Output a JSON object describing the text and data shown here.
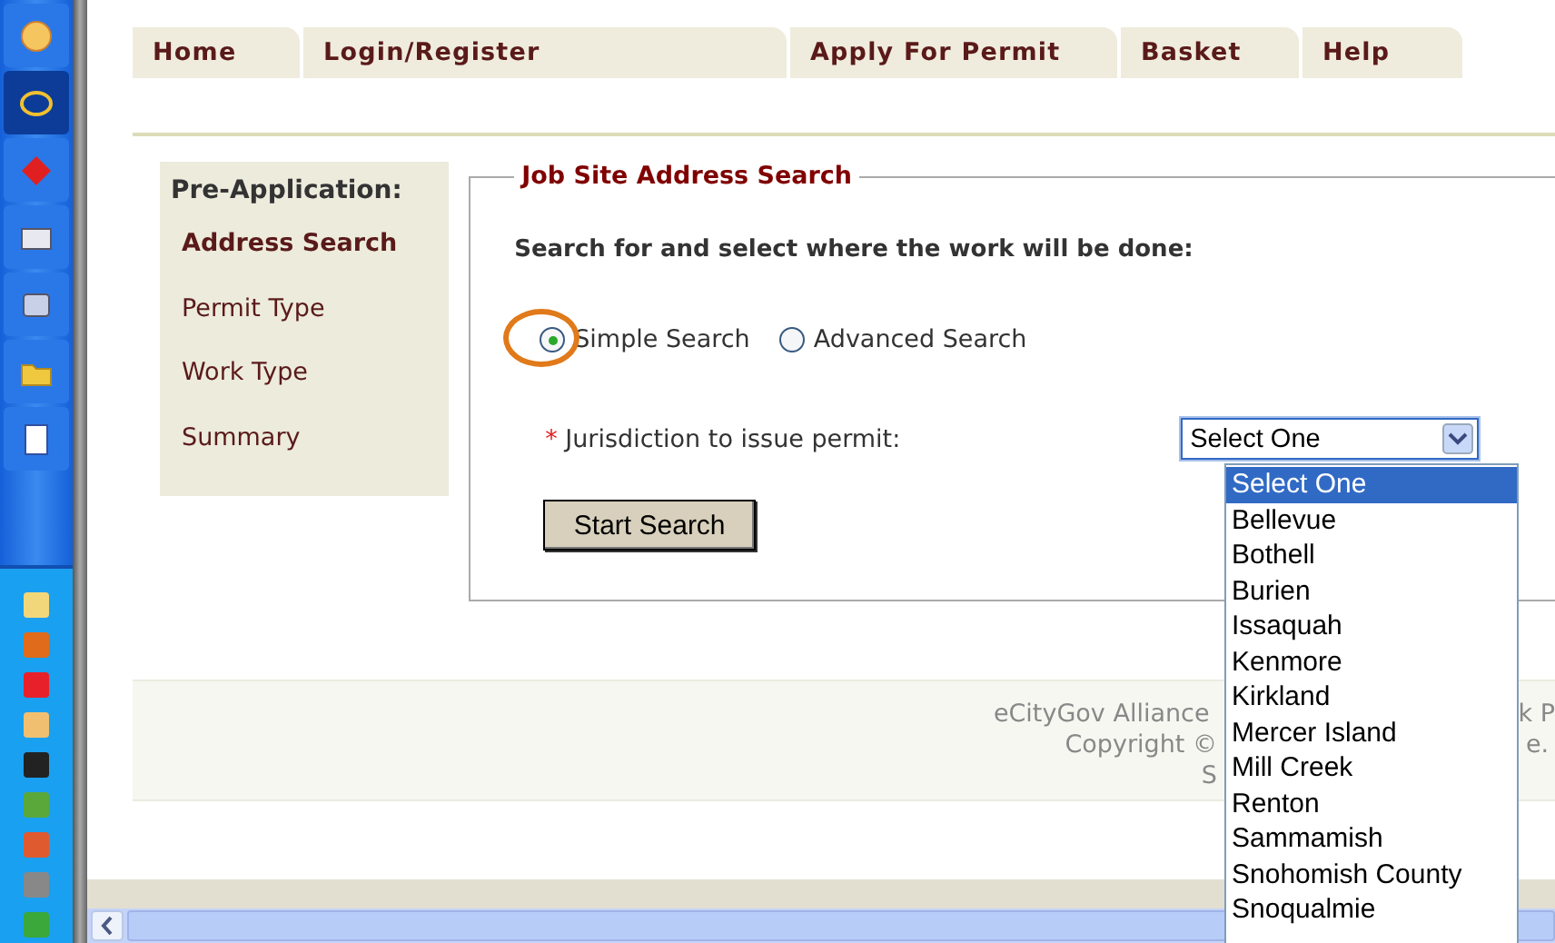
{
  "taskbar": {
    "tiles": [
      {
        "selected": false
      },
      {
        "selected": true
      },
      {
        "selected": false
      },
      {
        "selected": false
      },
      {
        "selected": false
      },
      {
        "selected": false
      },
      {
        "selected": false
      }
    ]
  },
  "nav_tabs": [
    {
      "label": "Home"
    },
    {
      "label": "Login/Register"
    },
    {
      "label": "Apply For Permit"
    },
    {
      "label": "Basket"
    },
    {
      "label": "Help"
    }
  ],
  "sidebar": {
    "heading": "Pre-Application:",
    "steps": [
      {
        "label": "Address Search",
        "selected": true
      },
      {
        "label": "Permit Type",
        "selected": false
      },
      {
        "label": "Work Type",
        "selected": false
      },
      {
        "label": "Summary",
        "selected": false
      }
    ]
  },
  "address_search": {
    "title": "Job Site Address Search",
    "instruction": "Search for and select where the work will be done:",
    "search_modes": [
      {
        "label": "Simple Search",
        "selected": true,
        "highlighted": true
      },
      {
        "label": "Advanced Search",
        "selected": false,
        "highlighted": false
      }
    ],
    "jurisdiction": {
      "required_mark": "*",
      "label": "Jurisdiction to issue permit:",
      "value": "Select One",
      "expanded": true,
      "options": [
        {
          "label": "Select One",
          "selected": true
        },
        {
          "label": "Bellevue",
          "selected": false
        },
        {
          "label": "Bothell",
          "selected": false
        },
        {
          "label": "Burien",
          "selected": false
        },
        {
          "label": "Issaquah",
          "selected": false
        },
        {
          "label": "Kenmore",
          "selected": false
        },
        {
          "label": "Kirkland",
          "selected": false
        },
        {
          "label": "Mercer Island",
          "selected": false
        },
        {
          "label": "Mill Creek",
          "selected": false
        },
        {
          "label": "Renton",
          "selected": false
        },
        {
          "label": "Sammamish",
          "selected": false
        },
        {
          "label": "Snohomish County",
          "selected": false
        },
        {
          "label": "Snoqualmie",
          "selected": false
        }
      ]
    },
    "start_button": "Start Search"
  },
  "footer": {
    "lines": [
      {
        "left": "eCityGov Alliance",
        "right": "k P"
      },
      {
        "left": "Copyright ©",
        "right": "e."
      },
      {
        "left": "S"
      }
    ]
  }
}
